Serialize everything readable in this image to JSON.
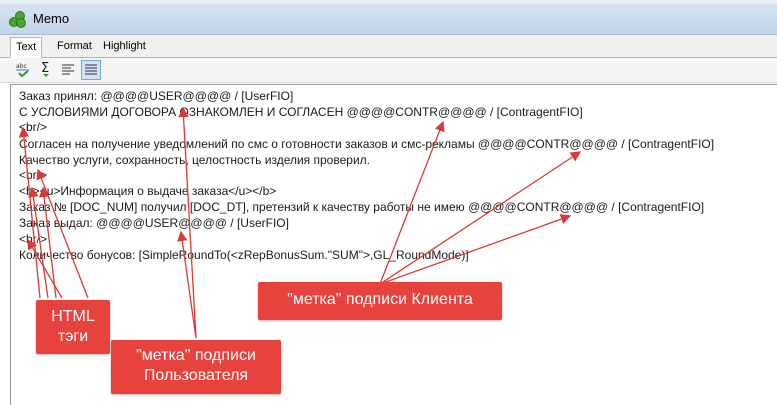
{
  "window": {
    "title": "Memo",
    "icon": "app-logo-icon"
  },
  "tabs": [
    {
      "label": "Text",
      "active": true
    },
    {
      "label": "Format",
      "active": false
    },
    {
      "label": "Highlight",
      "active": false
    }
  ],
  "toolbar": {
    "buttons": [
      {
        "icon": "spellcheck-icon"
      },
      {
        "icon": "sum-icon"
      },
      {
        "icon": "align-left-icon"
      },
      {
        "icon": "align-justify-icon",
        "active": true
      }
    ]
  },
  "editor": {
    "lines": [
      "Заказ принял: @@@@USER@@@@ / [UserFIO]",
      "С УСЛОВИЯМИ ДОГОВОРА ОЗНАКОМЛЕН И СОГЛАСЕН @@@@CONTR@@@@ / [ContragentFIO]",
      "<br/>",
      "Согласен на получение уведомлений по смс о готовности заказов и смс-рекламы @@@@CONTR@@@@ / [ContragentFIO]",
      "Качество услуги, сохранность, целостность изделия проверил.",
      "<br/>",
      "<b><u>Информация о выдаче заказа</u></b>",
      "Заказ № [DOC_NUM] получил [DOC_DT], претензий к качеству работы не имею @@@@CONTR@@@@ / [ContragentFIO]",
      "Заказ выдал: @@@@USER@@@@ / [UserFIO]",
      "<br/>",
      "Количество бонусов: [SimpleRoundTo(<zRepBonusSum.\"SUM\">,GL_RoundMode)]"
    ]
  },
  "annotations": {
    "html_tags": "HTML\nтэги",
    "user_mark": "\"метка\" подписи\nПользователя",
    "client_mark": "\"метка\" подписи Клиента"
  },
  "colors": {
    "accent": "#e8423f",
    "arrow": "#d93a36"
  }
}
